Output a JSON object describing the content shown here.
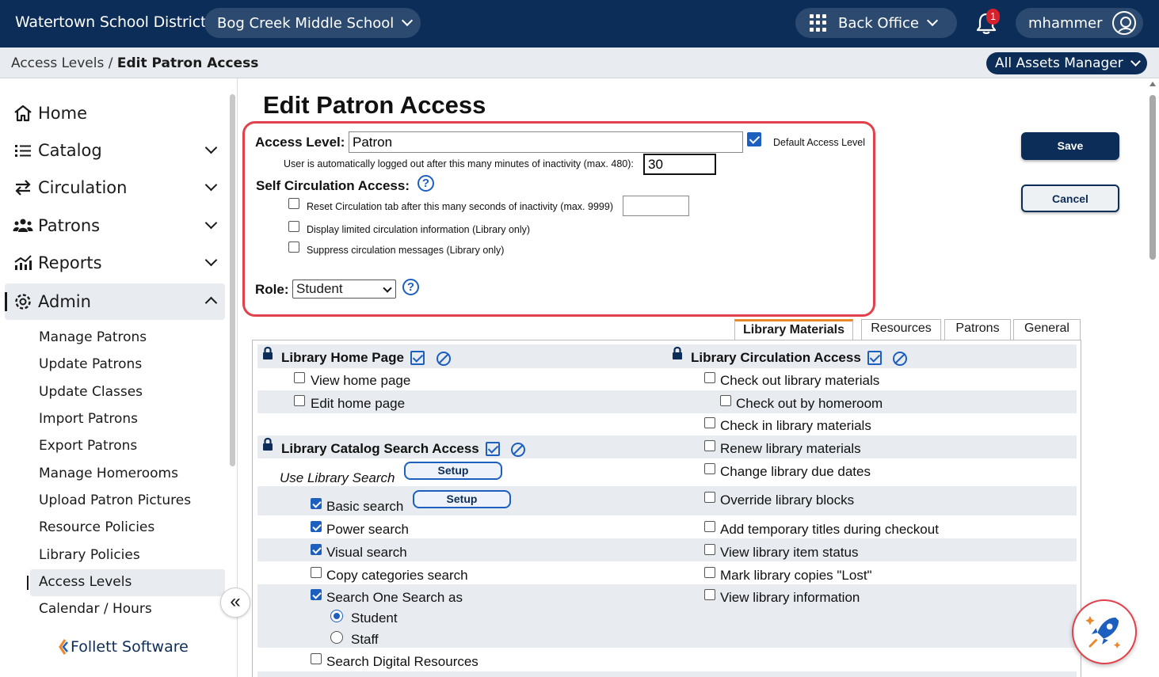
{
  "header": {
    "district": "Watertown School District",
    "school": "Bog Creek Middle School",
    "app": "Back Office",
    "notifications": "1",
    "user": "mhammer"
  },
  "breadcrumb": {
    "parent": "Access Levels",
    "separator": " / ",
    "current": "Edit Patron Access",
    "role": "All Assets Manager"
  },
  "sidebar": {
    "nav": [
      {
        "label": "Home",
        "icon": "home-icon"
      },
      {
        "label": "Catalog",
        "icon": "list-icon"
      },
      {
        "label": "Circulation",
        "icon": "swap-arrows-icon"
      },
      {
        "label": "Patrons",
        "icon": "people-icon"
      },
      {
        "label": "Reports",
        "icon": "chart-icon"
      },
      {
        "label": "Admin",
        "icon": "gear-icon"
      }
    ],
    "admin_items": [
      "Manage Patrons",
      "Update Patrons",
      "Update Classes",
      "Import Patrons",
      "Export Patrons",
      "Manage Homerooms",
      "Upload Patron Pictures",
      "Resource Policies",
      "Library Policies",
      "Access Levels",
      "Calendar / Hours"
    ],
    "collapse": "«",
    "logo": "Follett Software"
  },
  "page": {
    "title": "Edit Patron Access",
    "access_level_label": "Access Level:",
    "access_level_value": "Patron",
    "default_label": "Default Access Level",
    "logout_label": "User is automatically logged out after this many minutes of inactivity (max. 480):",
    "logout_value": "30",
    "self_circ_label": "Self Circulation Access:",
    "reset_label": "Reset Circulation tab after this many seconds of inactivity (max. 9999)",
    "reset_value": "",
    "limited_label": "Display limited circulation information (Library only)",
    "suppress_label": "Suppress circulation messages (Library only)",
    "role_label": "Role:",
    "role_value": "Student",
    "help": "?",
    "save": "Save",
    "cancel": "Cancel"
  },
  "tabs": [
    "Library Materials",
    "Resources",
    "Patrons",
    "General"
  ],
  "left_col": {
    "home_section": "Library Home Page",
    "view_home": "View home page",
    "edit_home": "Edit home page",
    "catalog_section": "Library Catalog Search Access",
    "use_search": "Use Library Search",
    "setup": "Setup",
    "basic": "Basic search",
    "power": "Power search",
    "visual": "Visual search",
    "copy_cat": "Copy categories search",
    "one_search": "Search One Search as",
    "student": "Student",
    "staff": "Staff",
    "digital": "Search Digital Resources"
  },
  "right_col": {
    "circ_section": "Library Circulation Access",
    "items": [
      "Check out library materials",
      "Check out by homeroom",
      "Check in library materials",
      "Renew library materials",
      "Change library due dates",
      "Override library blocks",
      "Add temporary titles during checkout",
      "View library item status",
      "Mark library copies \"Lost\"",
      "View library information"
    ]
  },
  "colors": {
    "navy": "#0c2d57",
    "accent_red": "#e0414b",
    "blue": "#1d5fbf",
    "tab_orange": "#e8882a"
  }
}
